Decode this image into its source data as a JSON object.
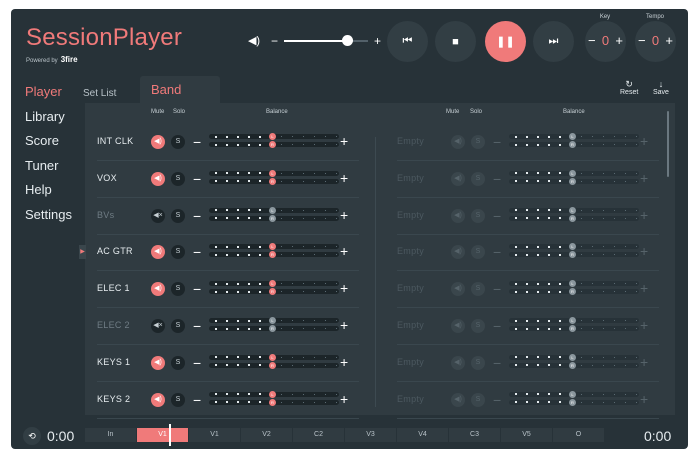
{
  "app": {
    "title": "SessionPlayer",
    "powered_by": "Powered by",
    "brand": "3fire"
  },
  "transport": {
    "volume": 0.75,
    "prev_icon": "⏮",
    "stop_icon": "■",
    "pause_icon": "❚❚",
    "next_icon": "⏭"
  },
  "key": {
    "label": "Key",
    "value": "0"
  },
  "tempo": {
    "label": "Tempo",
    "value": "0"
  },
  "nav": [
    "Player",
    "Library",
    "Score",
    "Tuner",
    "Help",
    "Settings"
  ],
  "tabs": {
    "setlist": "Set List",
    "band": "Band"
  },
  "actions": {
    "reset": "Reset",
    "save": "Save"
  },
  "columns": {
    "mute": "Mute",
    "solo": "Solo",
    "balance": "Balance",
    "solo_button": "S"
  },
  "tracks_left": [
    {
      "name": "INT CLK",
      "muted": false,
      "dim": false
    },
    {
      "name": "VOX",
      "muted": false,
      "dim": false
    },
    {
      "name": "BVs",
      "muted": true,
      "dim": true
    },
    {
      "name": "AC GTR",
      "muted": false,
      "dim": false
    },
    {
      "name": "ELEC 1",
      "muted": false,
      "dim": false
    },
    {
      "name": "ELEC 2",
      "muted": true,
      "dim": true
    },
    {
      "name": "KEYS 1",
      "muted": false,
      "dim": false
    },
    {
      "name": "KEYS 2",
      "muted": false,
      "dim": false
    }
  ],
  "tracks_right": [
    "Empty",
    "Empty",
    "Empty",
    "Empty",
    "Empty",
    "Empty",
    "Empty",
    "Empty"
  ],
  "footer": {
    "time_left": "0:00",
    "time_right": "0:00",
    "sections": [
      "In",
      "V1",
      "V1",
      "V2",
      "C2",
      "V3",
      "V4",
      "C3",
      "V5",
      "O"
    ],
    "current": 1
  },
  "colors": {
    "accent": "#f07a7a",
    "bg": "#273238",
    "panel": "#303b41"
  }
}
